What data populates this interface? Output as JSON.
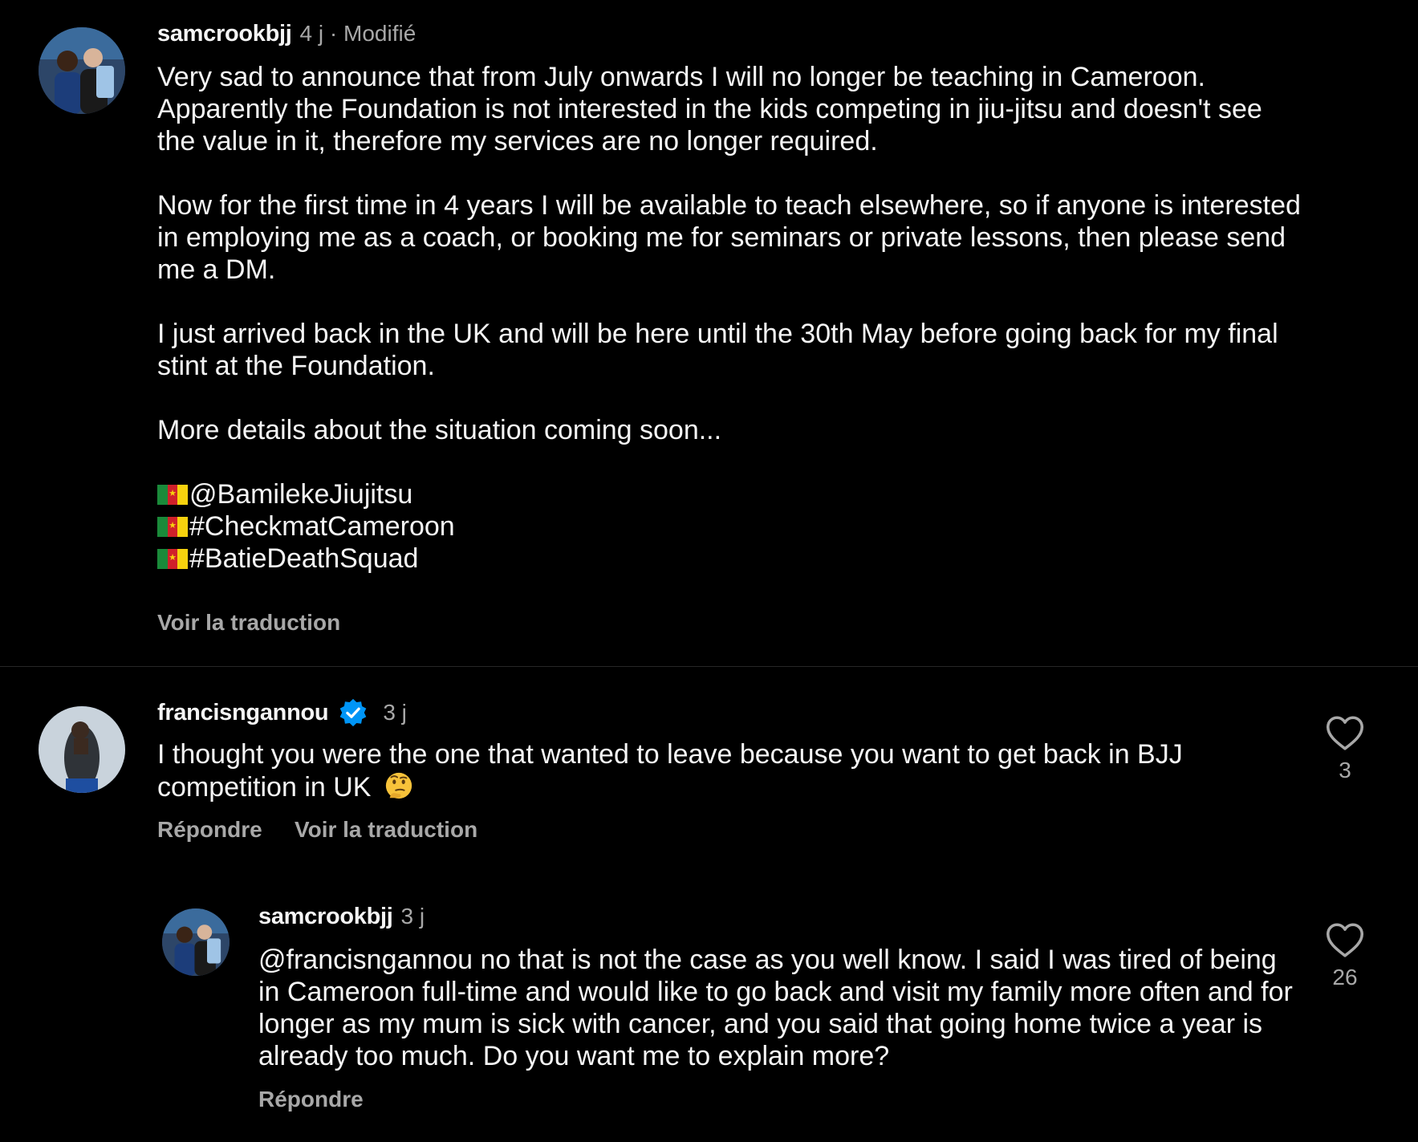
{
  "post": {
    "username": "samcrookbjj",
    "meta": "4 j · Modifié",
    "paragraphs": [
      "Very sad to announce that from July onwards I will no longer be teaching in Cameroon. Apparently the Foundation is not interested in the kids competing in jiu-jitsu and doesn't see the value in it, therefore my services are no longer required.",
      "Now for the first time in 4 years I will be available to teach elsewhere, so if anyone is interested in employing me as a coach, or booking me for seminars or private lessons, then please send me a DM.",
      "I just arrived back in the UK and will be here until the 30th May before going back for my final stint at the Foundation.",
      "More details about the situation coming soon..."
    ],
    "tags": [
      "@BamilekeJiujitsu",
      "#CheckmatCameroon",
      "#BatieDeathSquad"
    ],
    "translate_label": "Voir la traduction"
  },
  "comments": [
    {
      "username": "francisngannou",
      "verified": true,
      "time": "3 j",
      "text": "I thought you were the one that wanted to leave because you want to get back in BJJ competition in UK",
      "emoji": "thinking-face",
      "reply_label": "Répondre",
      "translate_label": "Voir la traduction",
      "likes": "3"
    },
    {
      "username": "samcrookbjj",
      "time": "3 j",
      "text": "@francisngannou no that is not the case as you well know. I said I was tired of being in Cameroon full-time and would like to go back and visit my family more often and for longer as my mum is sick with cancer, and you said that going home twice a year is already too much. Do you want me to explain more?",
      "reply_label": "Répondre",
      "likes": "26"
    }
  ],
  "colors": {
    "background": "#000000",
    "text": "#f5f5f5",
    "secondary": "#a8a8a8",
    "verified_badge": "#0095f6"
  },
  "icons": [
    "heart-outline-icon",
    "verified-badge-icon",
    "cameroon-flag-icon",
    "thinking-face-emoji"
  ]
}
